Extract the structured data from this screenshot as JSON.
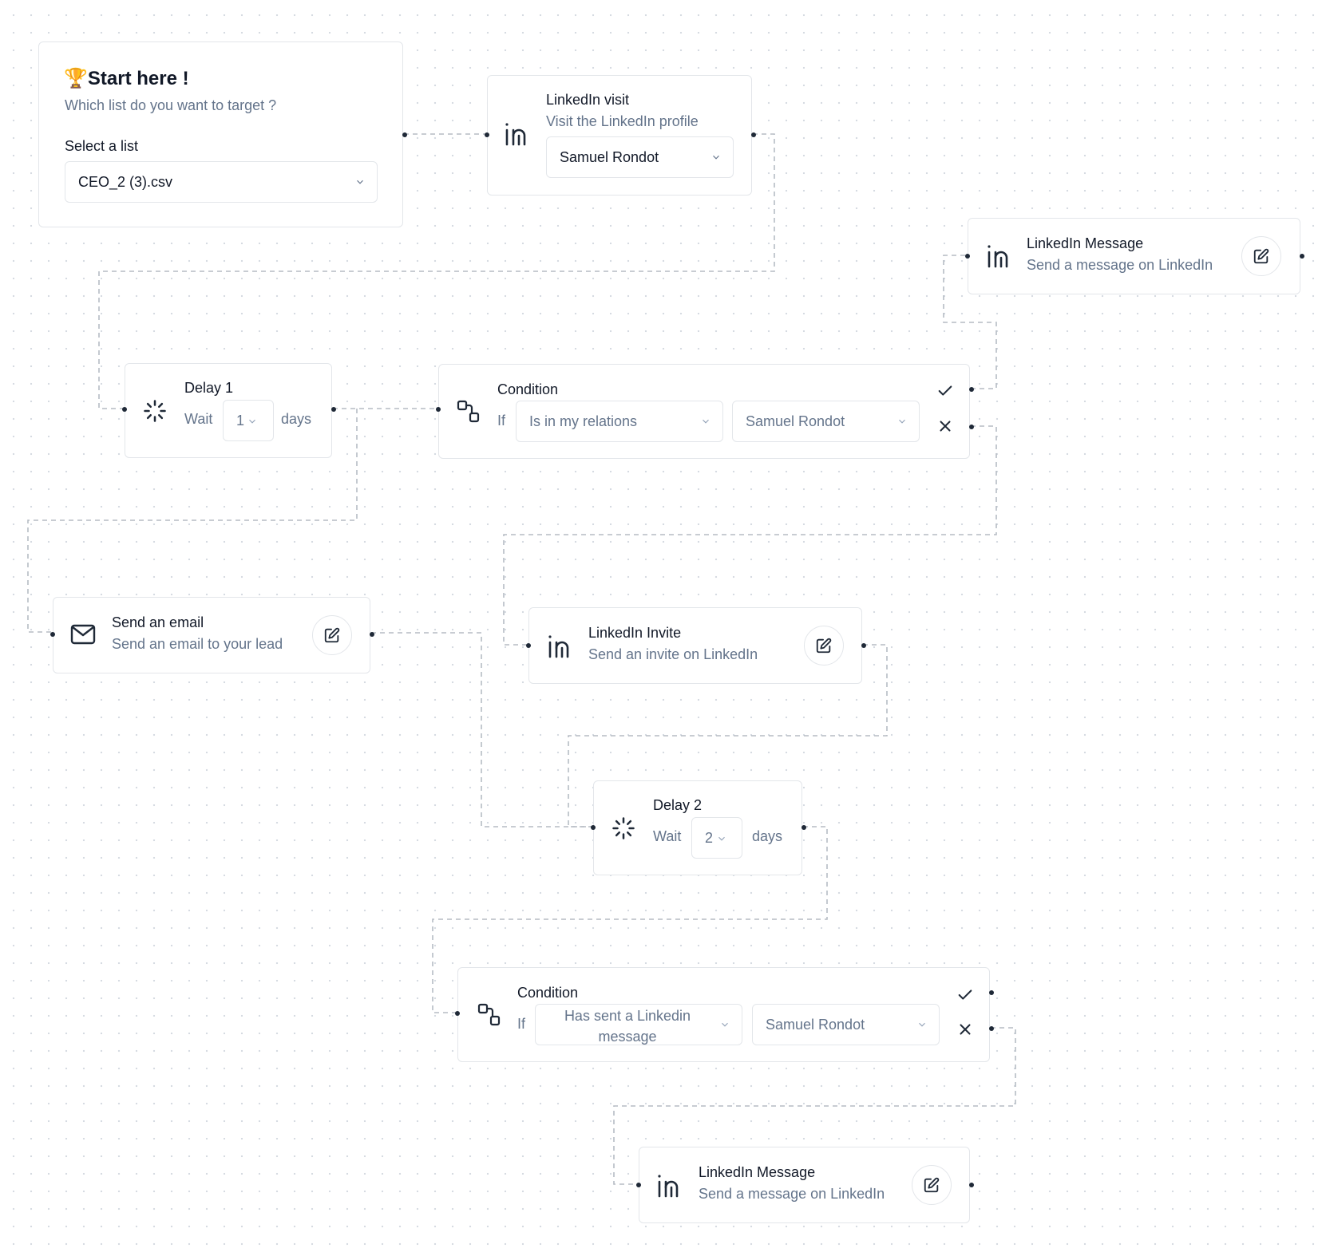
{
  "start": {
    "emoji": "🏆",
    "title": "Start here !",
    "subtitle": "Which list do you want to target ?",
    "select_label": "Select a list",
    "select_value": "CEO_2 (3).csv"
  },
  "linkedin_visit": {
    "title": "LinkedIn visit",
    "subtitle": "Visit the LinkedIn profile",
    "account": "Samuel Rondot"
  },
  "linkedin_message_1": {
    "title": "LinkedIn Message",
    "subtitle": "Send a message on LinkedIn"
  },
  "delay_1": {
    "title": "Delay 1",
    "wait_label": "Wait",
    "value": "1",
    "unit": "days"
  },
  "condition_1": {
    "title": "Condition",
    "if_label": "If",
    "rule": "Is in my relations",
    "account": "Samuel Rondot"
  },
  "send_email": {
    "title": "Send an email",
    "subtitle": "Send an email to your lead"
  },
  "linkedin_invite": {
    "title": "LinkedIn Invite",
    "subtitle": "Send an invite on LinkedIn"
  },
  "delay_2": {
    "title": "Delay 2",
    "wait_label": "Wait",
    "value": "2",
    "unit": "days"
  },
  "condition_2": {
    "title": "Condition",
    "if_label": "If",
    "rule_line1": "Has sent a Linkedin",
    "rule_line2": "message",
    "account": "Samuel Rondot"
  },
  "linkedin_message_2": {
    "title": "LinkedIn Message",
    "subtitle": "Send a message on LinkedIn"
  },
  "icons": {
    "linkedin": "linkedin-icon",
    "delay": "loader-icon",
    "condition": "branch-icon",
    "email": "mail-icon",
    "edit": "edit-icon",
    "chevron": "chevron-down-icon",
    "yes": "check-icon",
    "no": "x-icon"
  },
  "colors": {
    "edge": "#b6bcc4",
    "muted_text": "#64748b",
    "border": "#e3e6ea"
  }
}
